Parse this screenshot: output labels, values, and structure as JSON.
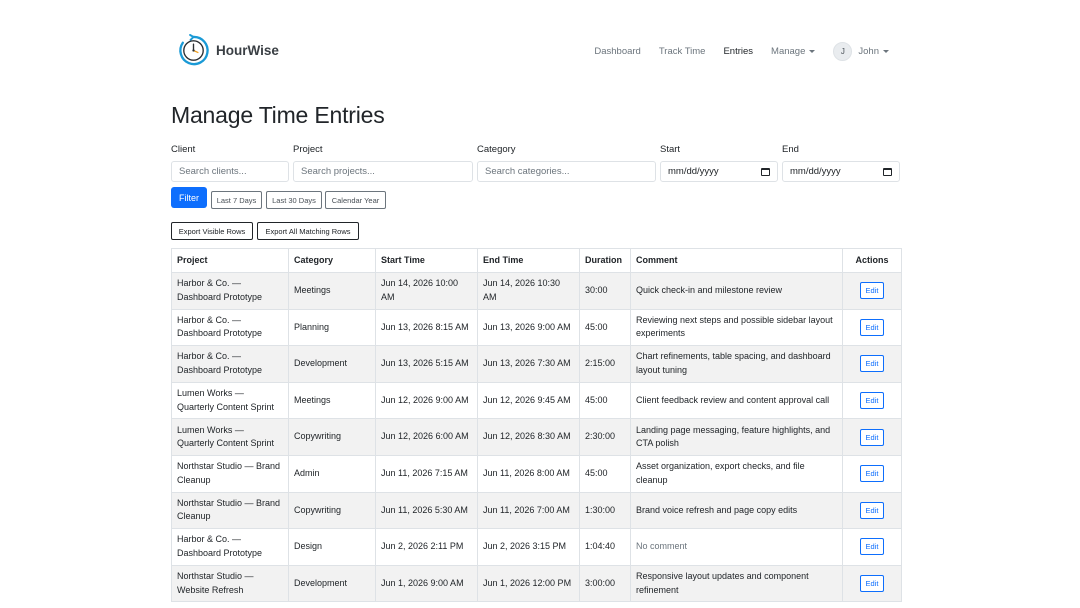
{
  "brand": {
    "name": "HourWise"
  },
  "nav": {
    "links": [
      {
        "label": "Dashboard"
      },
      {
        "label": "Track Time"
      },
      {
        "label": "Entries"
      },
      {
        "label": "Manage"
      }
    ],
    "user": {
      "initial": "J",
      "name": "John"
    }
  },
  "page": {
    "title": "Manage Time Entries"
  },
  "filters": {
    "client": {
      "label": "Client",
      "placeholder": "Search clients..."
    },
    "project": {
      "label": "Project",
      "placeholder": "Search projects..."
    },
    "category": {
      "label": "Category",
      "placeholder": "Search categories..."
    },
    "start": {
      "label": "Start",
      "placeholder": "mm/dd/yyyy"
    },
    "end": {
      "label": "End",
      "placeholder": "mm/dd/yyyy"
    },
    "filter_label": "Filter",
    "quick": [
      "Last 7 Days",
      "Last 30 Days",
      "Calendar Year"
    ],
    "export_visible": "Export Visible Rows",
    "export_all": "Export All Matching Rows"
  },
  "table": {
    "headers": [
      "Project",
      "Category",
      "Start Time",
      "End Time",
      "Duration",
      "Comment",
      "Actions"
    ],
    "edit_label": "Edit",
    "rows": [
      {
        "project": "Harbor & Co. — Dashboard Prototype",
        "category": "Meetings",
        "start": "Jun 14, 2026 10:00 AM",
        "end": "Jun 14, 2026 10:30 AM",
        "duration": "30:00",
        "comment": "Quick check-in and milestone review"
      },
      {
        "project": "Harbor & Co. — Dashboard Prototype",
        "category": "Planning",
        "start": "Jun 13, 2026 8:15 AM",
        "end": "Jun 13, 2026 9:00 AM",
        "duration": "45:00",
        "comment": "Reviewing next steps and possible sidebar layout experiments"
      },
      {
        "project": "Harbor & Co. — Dashboard Prototype",
        "category": "Development",
        "start": "Jun 13, 2026 5:15 AM",
        "end": "Jun 13, 2026 7:30 AM",
        "duration": "2:15:00",
        "comment": "Chart refinements, table spacing, and dashboard layout tuning"
      },
      {
        "project": "Lumen Works — Quarterly Content Sprint",
        "category": "Meetings",
        "start": "Jun 12, 2026 9:00 AM",
        "end": "Jun 12, 2026 9:45 AM",
        "duration": "45:00",
        "comment": "Client feedback review and content approval call"
      },
      {
        "project": "Lumen Works — Quarterly Content Sprint",
        "category": "Copywriting",
        "start": "Jun 12, 2026 6:00 AM",
        "end": "Jun 12, 2026 8:30 AM",
        "duration": "2:30:00",
        "comment": "Landing page messaging, feature highlights, and CTA polish"
      },
      {
        "project": "Northstar Studio — Brand Cleanup",
        "category": "Admin",
        "start": "Jun 11, 2026 7:15 AM",
        "end": "Jun 11, 2026 8:00 AM",
        "duration": "45:00",
        "comment": "Asset organization, export checks, and file cleanup"
      },
      {
        "project": "Northstar Studio — Brand Cleanup",
        "category": "Copywriting",
        "start": "Jun 11, 2026 5:30 AM",
        "end": "Jun 11, 2026 7:00 AM",
        "duration": "1:30:00",
        "comment": "Brand voice refresh and page copy edits"
      },
      {
        "project": "Harbor & Co. — Dashboard Prototype",
        "category": "Design",
        "start": "Jun 2, 2026 2:11 PM",
        "end": "Jun 2, 2026 3:15 PM",
        "duration": "1:04:40",
        "comment": "No comment",
        "comment_muted": true
      },
      {
        "project": "Northstar Studio — Website Refresh",
        "category": "Development",
        "start": "Jun 1, 2026 9:00 AM",
        "end": "Jun 1, 2026 12:00 PM",
        "duration": "3:00:00",
        "comment": "Responsive layout updates and component refinement"
      }
    ]
  },
  "colors": {
    "primary": "#0d6efd",
    "stripe": "#f2f2f2",
    "border": "#dee2e6",
    "muted": "#6c757d"
  }
}
